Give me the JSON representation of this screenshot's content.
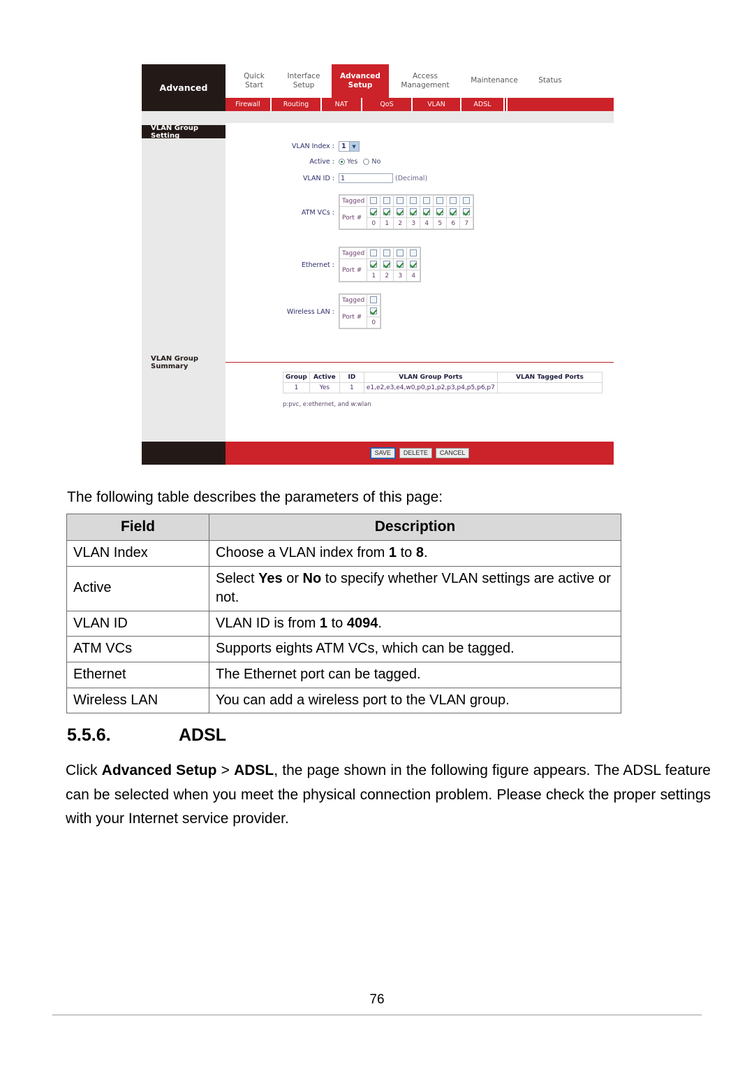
{
  "figure": {
    "brand_label": "Advanced",
    "top_nav": [
      {
        "label": "Quick\nStart",
        "active": false
      },
      {
        "label": "Interface\nSetup",
        "active": false
      },
      {
        "label": "Advanced\nSetup",
        "active": true
      },
      {
        "label": "Access\nManagement",
        "active": false
      },
      {
        "label": "Maintenance",
        "active": false
      },
      {
        "label": "Status",
        "active": false
      }
    ],
    "sub_nav": [
      {
        "label": "Firewall"
      },
      {
        "label": "Routing"
      },
      {
        "label": "NAT"
      },
      {
        "label": "QoS"
      },
      {
        "label": "VLAN"
      },
      {
        "label": "ADSL"
      }
    ],
    "section_setting_label": "VLAN Group Setting",
    "section_summary_label": "VLAN Group Summary",
    "form": {
      "vlan_index_label": "VLAN Index :",
      "vlan_index_value": "1",
      "active_label": "Active :",
      "active_yes": "Yes",
      "active_no": "No",
      "active_selected": "Yes",
      "vlan_id_label": "VLAN ID :",
      "vlan_id_value": "1",
      "vlan_id_hint": "(Decimal)",
      "atm_vcs_label": "ATM VCs :",
      "ethernet_label": "Ethernet :",
      "wireless_lan_label": "Wireless LAN :",
      "tagged_row_label": "Tagged",
      "port_row_label": "Port #",
      "atm_vcs": {
        "ports": [
          "0",
          "1",
          "2",
          "3",
          "4",
          "5",
          "6",
          "7"
        ],
        "tagged": [
          false,
          false,
          false,
          false,
          false,
          false,
          false,
          false
        ],
        "member": [
          true,
          true,
          true,
          true,
          true,
          true,
          true,
          true
        ]
      },
      "ethernet": {
        "ports": [
          "1",
          "2",
          "3",
          "4"
        ],
        "tagged": [
          false,
          false,
          false,
          false
        ],
        "member": [
          true,
          true,
          true,
          true
        ]
      },
      "wireless_lan": {
        "ports": [
          "0"
        ],
        "tagged": [
          false
        ],
        "member": [
          true
        ]
      }
    },
    "summary": {
      "headers": [
        "Group",
        "Active",
        "ID",
        "VLAN Group Ports",
        "VLAN Tagged Ports"
      ],
      "rows": [
        {
          "group": "1",
          "active": "Yes",
          "id": "1",
          "group_ports": "e1,e2,e3,e4,w0,p0,p1,p2,p3,p4,p5,p6,p7",
          "tagged_ports": ""
        }
      ],
      "note": "p:pvc, e:ethernet, and w:wlan"
    },
    "buttons": {
      "save": "SAVE",
      "delete": "DELETE",
      "cancel": "CANCEL"
    },
    "colors": {
      "red": "#cc2229",
      "dark": "#231a18",
      "sidebar_gray": "#e9e9e9"
    }
  },
  "document": {
    "intro_line": "The following table describes the parameters of this page:",
    "param_table": {
      "headers": [
        "Field",
        "Description"
      ],
      "rows": [
        {
          "field": "VLAN Index",
          "description_html": "Choose a VLAN index from <b>1</b> to <b>8</b>."
        },
        {
          "field": "Active",
          "description_html": "Select <b>Yes</b> or <b>No</b> to specify whether VLAN settings are active or not."
        },
        {
          "field": "VLAN ID",
          "description_html": "VLAN ID is from <b>1</b> to <b>4094</b>."
        },
        {
          "field": "ATM VCs",
          "description_html": "Supports eights ATM VCs, which can be tagged."
        },
        {
          "field": "Ethernet",
          "description_html": "The Ethernet port can be tagged."
        },
        {
          "field": "Wireless LAN",
          "description_html": "You can add a wireless port to the VLAN group."
        }
      ]
    },
    "section": {
      "number": "5.5.6.",
      "title": "ADSL"
    },
    "paragraph_html": "Click <b>Advanced Setup</b> &gt; <b>ADSL</b>, the page shown in the following figure appears. The ADSL feature can be selected when you meet the physical connection problem. Please check the proper settings with your Internet service provider.",
    "page_number": "76"
  }
}
